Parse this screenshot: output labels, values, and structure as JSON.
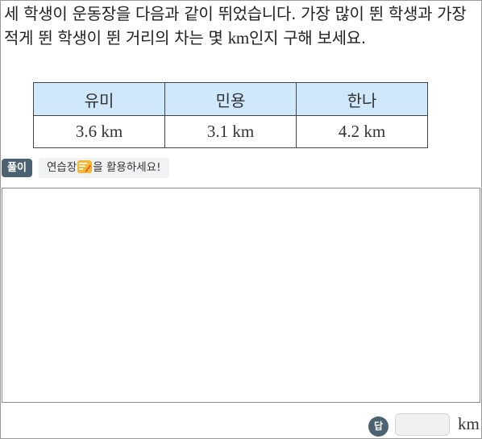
{
  "question": {
    "part1": "세 학생이 운동장을 다음과 같이 뛰었습니다. 가장 많이 뛴 학생과 가장 적게 뛴 학생이 뛴 거리의 차는 몇 ",
    "unit": "km",
    "part2": "인지 구해 보세요."
  },
  "table": {
    "headers": [
      "유미",
      "민용",
      "한나"
    ],
    "values": [
      "3.6 km",
      "3.1 km",
      "4.2 km"
    ]
  },
  "solution": {
    "badge": "풀이",
    "hint_prefix": "연습장",
    "hint_suffix": "을 활용하세요!"
  },
  "answer": {
    "badge": "답",
    "value": "",
    "unit": "km"
  },
  "colors": {
    "header_bg": "#cfe8fb",
    "badge_bg": "#4a6272",
    "icon": "#f3b832"
  },
  "icons": {
    "notepad": "notepad-pencil-icon"
  }
}
